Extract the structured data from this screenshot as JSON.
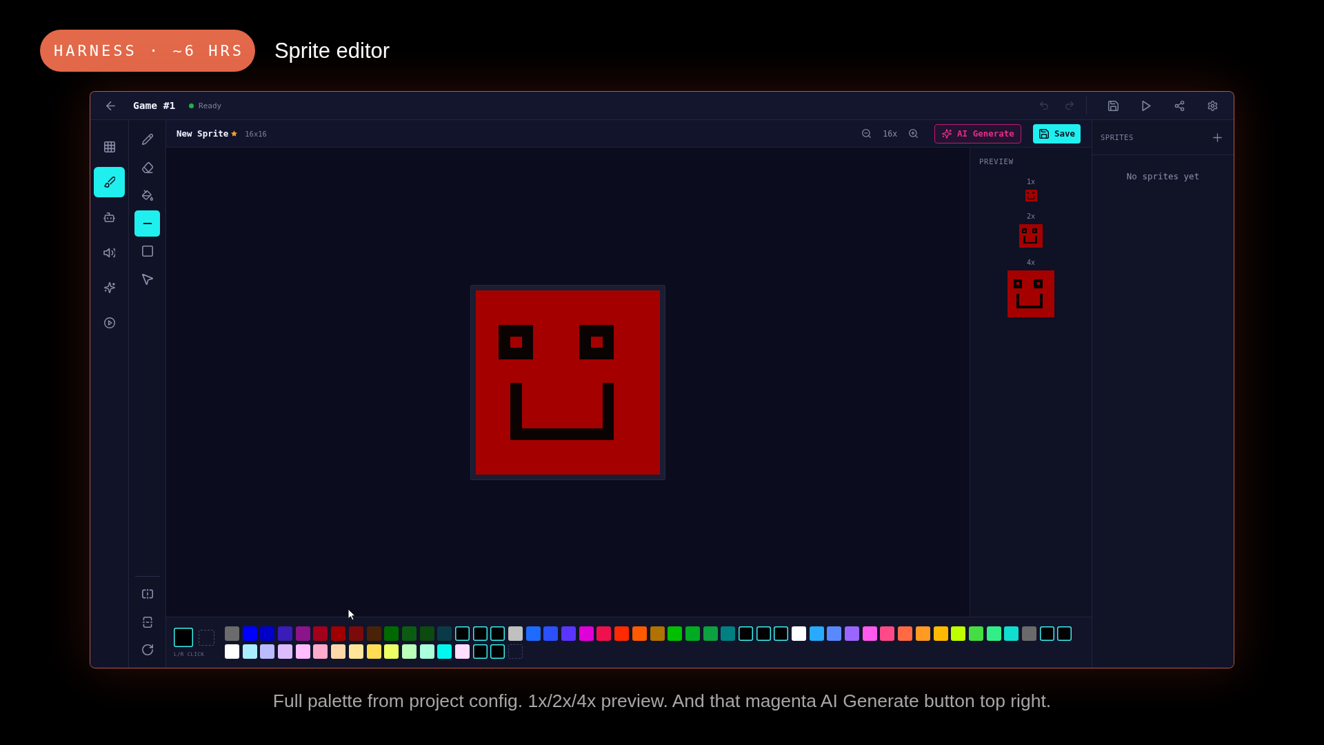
{
  "header": {
    "badge": "HARNESS · ~6 HRS",
    "title": "Sprite editor"
  },
  "topbar": {
    "project": "Game #1",
    "status": "Ready",
    "undo": {
      "disabled": true
    },
    "redo": {
      "disabled": true
    }
  },
  "nav": [
    {
      "selected": false
    },
    {
      "selected": true
    },
    {
      "selected": false
    },
    {
      "selected": false
    },
    {
      "selected": false
    },
    {
      "selected": false
    }
  ],
  "tools": [
    {
      "selected": false
    },
    {
      "selected": false
    },
    {
      "selected": false
    },
    {
      "selected": true
    },
    {
      "selected": false
    },
    {
      "selected": false
    }
  ],
  "sprite": {
    "name": "New Sprite",
    "modified": true,
    "size": "16x16",
    "zoom": "16x"
  },
  "actions": {
    "ai_generate": "AI Generate",
    "save": "Save"
  },
  "preview": {
    "title": "PREVIEW",
    "scales": [
      "1x",
      "2x",
      "4x"
    ]
  },
  "sprites_panel": {
    "title": "SPRITES",
    "empty_message": "No sprites yet"
  },
  "palette": {
    "primary": {
      "kind": "color",
      "color": "#000000"
    },
    "secondary": {
      "kind": "transparent"
    },
    "hint": "L/R CLICK",
    "rows": [
      [
        {
          "kind": "color",
          "color": "#6b6b6b",
          "selected": false
        },
        {
          "kind": "color",
          "color": "#0000ff",
          "selected": false
        },
        {
          "kind": "color",
          "color": "#0000c8",
          "selected": false
        },
        {
          "kind": "color",
          "color": "#3a1cb8",
          "selected": false
        },
        {
          "kind": "color",
          "color": "#8b148b",
          "selected": false
        },
        {
          "kind": "color",
          "color": "#a3001c",
          "selected": false
        },
        {
          "kind": "color",
          "color": "#a00000",
          "selected": false
        },
        {
          "kind": "color",
          "color": "#7c0a0a",
          "selected": false
        },
        {
          "kind": "color",
          "color": "#4a2208",
          "selected": false
        },
        {
          "kind": "color",
          "color": "#006a00",
          "selected": false
        },
        {
          "kind": "color",
          "color": "#0b5c12",
          "selected": false
        },
        {
          "kind": "color",
          "color": "#0c4a10",
          "selected": false
        },
        {
          "kind": "color",
          "color": "#0a3a48",
          "selected": false
        },
        {
          "kind": "color",
          "color": "#000000",
          "selected": true
        },
        {
          "kind": "color",
          "color": "#000000",
          "selected": true
        },
        {
          "kind": "color",
          "color": "#000000",
          "selected": true
        },
        {
          "kind": "color",
          "color": "#c0c0c0",
          "selected": false
        },
        {
          "kind": "color",
          "color": "#1e6bff",
          "selected": false
        },
        {
          "kind": "color",
          "color": "#2a50ff",
          "selected": false
        },
        {
          "kind": "color",
          "color": "#5a35ff",
          "selected": false
        },
        {
          "kind": "color",
          "color": "#e000d8",
          "selected": false
        },
        {
          "kind": "color",
          "color": "#f0104e",
          "selected": false
        },
        {
          "kind": "color",
          "color": "#ff2a00",
          "selected": false
        },
        {
          "kind": "color",
          "color": "#ff5a00",
          "selected": false
        },
        {
          "kind": "color",
          "color": "#b07200",
          "selected": false
        },
        {
          "kind": "color",
          "color": "#00c000",
          "selected": false
        },
        {
          "kind": "color",
          "color": "#00aa22",
          "selected": false
        },
        {
          "kind": "color",
          "color": "#0ca040",
          "selected": false
        },
        {
          "kind": "color",
          "color": "#008080",
          "selected": false
        },
        {
          "kind": "color",
          "color": "#000000",
          "selected": true
        },
        {
          "kind": "color",
          "color": "#000000",
          "selected": true
        },
        {
          "kind": "color",
          "color": "#000000",
          "selected": true
        },
        {
          "kind": "color",
          "color": "#ffffff",
          "selected": false
        },
        {
          "kind": "color",
          "color": "#28aaff",
          "selected": false
        },
        {
          "kind": "color",
          "color": "#5a88ff",
          "selected": false
        },
        {
          "kind": "color",
          "color": "#9a66ff",
          "selected": false
        },
        {
          "kind": "color",
          "color": "#ff5aee",
          "selected": false
        },
        {
          "kind": "color",
          "color": "#ff4a88",
          "selected": false
        },
        {
          "kind": "color",
          "color": "#ff6a44",
          "selected": false
        },
        {
          "kind": "color",
          "color": "#ff9a22",
          "selected": false
        },
        {
          "kind": "color",
          "color": "#ffba00",
          "selected": false
        },
        {
          "kind": "color",
          "color": "#c0ff00",
          "selected": false
        },
        {
          "kind": "color",
          "color": "#44dd44",
          "selected": false
        },
        {
          "kind": "color",
          "color": "#33ee88",
          "selected": false
        },
        {
          "kind": "color",
          "color": "#10dcd0",
          "selected": false
        },
        {
          "kind": "color",
          "color": "#6a6a6a",
          "selected": false
        },
        {
          "kind": "color",
          "color": "#000000",
          "selected": true
        },
        {
          "kind": "color",
          "color": "#000000",
          "selected": true
        }
      ],
      [
        {
          "kind": "color",
          "color": "#ffffff",
          "selected": false
        },
        {
          "kind": "color",
          "color": "#aaeeff",
          "selected": false
        },
        {
          "kind": "color",
          "color": "#bbbbff",
          "selected": false
        },
        {
          "kind": "color",
          "color": "#dcbcff",
          "selected": false
        },
        {
          "kind": "color",
          "color": "#ffbcff",
          "selected": false
        },
        {
          "kind": "color",
          "color": "#ffaacc",
          "selected": false
        },
        {
          "kind": "color",
          "color": "#ffd8aa",
          "selected": false
        },
        {
          "kind": "color",
          "color": "#ffe599",
          "selected": false
        },
        {
          "kind": "color",
          "color": "#ffdd55",
          "selected": false
        },
        {
          "kind": "color",
          "color": "#eeff66",
          "selected": false
        },
        {
          "kind": "color",
          "color": "#bbffbb",
          "selected": false
        },
        {
          "kind": "color",
          "color": "#aaffdd",
          "selected": false
        },
        {
          "kind": "color",
          "color": "#00f8ee",
          "selected": false
        },
        {
          "kind": "color",
          "color": "#ffddff",
          "selected": false
        },
        {
          "kind": "color",
          "color": "#000000",
          "selected": true
        },
        {
          "kind": "color",
          "color": "#000000",
          "selected": true
        },
        {
          "kind": "transparent",
          "selected": false
        }
      ]
    ]
  },
  "caption": "Full palette from project config. 1x/2x/4x preview. And that magenta AI Generate button top right."
}
